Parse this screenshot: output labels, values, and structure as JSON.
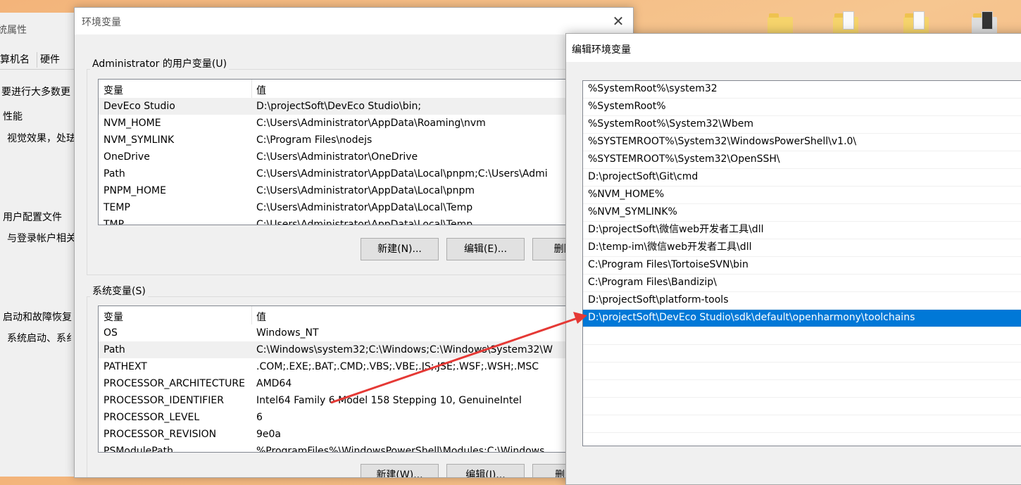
{
  "system_properties": {
    "title": "统属性",
    "tabs": [
      "算机名",
      "硬件"
    ],
    "intro": "要进行大多数更",
    "performance": {
      "heading": "性能",
      "desc": "视觉效果，处珐"
    },
    "user_profiles": {
      "heading": "用户配置文件",
      "desc": "与登录帐户相关"
    },
    "startup": {
      "heading": "启动和故障恢复",
      "desc": "系统启动、系纟"
    }
  },
  "env_window": {
    "title": "环境变量",
    "user_group_label": "Administrator 的用户变量(U)",
    "system_group_label": "系统变量(S)",
    "col_var": "变量",
    "col_val": "值",
    "user_vars": [
      {
        "name": "DevEco Studio",
        "value": "D:\\projectSoft\\DevEco Studio\\bin;"
      },
      {
        "name": "NVM_HOME",
        "value": "C:\\Users\\Administrator\\AppData\\Roaming\\nvm"
      },
      {
        "name": "NVM_SYMLINK",
        "value": "C:\\Program Files\\nodejs"
      },
      {
        "name": "OneDrive",
        "value": "C:\\Users\\Administrator\\OneDrive"
      },
      {
        "name": "Path",
        "value": "C:\\Users\\Administrator\\AppData\\Local\\pnpm;C:\\Users\\Admi"
      },
      {
        "name": "PNPM_HOME",
        "value": "C:\\Users\\Administrator\\AppData\\Local\\pnpm"
      },
      {
        "name": "TEMP",
        "value": "C:\\Users\\Administrator\\AppData\\Local\\Temp"
      },
      {
        "name": "TMP",
        "value": "C:\\Users\\Administrator\\AppData\\Local\\Temp"
      }
    ],
    "system_vars": [
      {
        "name": "OS",
        "value": "Windows_NT"
      },
      {
        "name": "Path",
        "value": "C:\\Windows\\system32;C:\\Windows;C:\\Windows\\System32\\W"
      },
      {
        "name": "PATHEXT",
        "value": ".COM;.EXE;.BAT;.CMD;.VBS;.VBE;.JS;.JSE;.WSF;.WSH;.MSC"
      },
      {
        "name": "PROCESSOR_ARCHITECTURE",
        "value": "AMD64"
      },
      {
        "name": "PROCESSOR_IDENTIFIER",
        "value": "Intel64 Family 6 Model 158 Stepping 10, GenuineIntel"
      },
      {
        "name": "PROCESSOR_LEVEL",
        "value": "6"
      },
      {
        "name": "PROCESSOR_REVISION",
        "value": "9e0a"
      },
      {
        "name": "PSModulePath",
        "value": "%ProgramFiles%\\WindowsPowerShell\\Modules;C:\\Windows"
      }
    ],
    "user_buttons": {
      "new": "新建(N)...",
      "edit": "编辑(E)...",
      "delete": "删除(D)"
    },
    "system_buttons": {
      "new": "新建(W)...",
      "edit": "编辑(I)...",
      "delete": "删除(L)"
    }
  },
  "edit_window": {
    "title": "编辑环境变量",
    "entries": [
      "%SystemRoot%\\system32",
      "%SystemRoot%",
      "%SystemRoot%\\System32\\Wbem",
      "%SYSTEMROOT%\\System32\\WindowsPowerShell\\v1.0\\",
      "%SYSTEMROOT%\\System32\\OpenSSH\\",
      "D:\\projectSoft\\Git\\cmd",
      "%NVM_HOME%",
      "%NVM_SYMLINK%",
      "D:\\projectSoft\\微信web开发者工具\\dll",
      "D:\\temp-im\\微信web开发者工具\\dll",
      "C:\\Program Files\\TortoiseSVN\\bin",
      "C:\\Program Files\\Bandizip\\",
      "D:\\projectSoft\\platform-tools",
      "D:\\projectSoft\\DevEco Studio\\sdk\\default\\openharmony\\toolchains"
    ],
    "selected_index": 13
  },
  "colors": {
    "selection": "#0078d7",
    "arrow": "#e53935"
  },
  "icons": [
    "folder-icon",
    "folder-icon",
    "folder-icon",
    "folder-icon",
    "close-icon"
  ]
}
